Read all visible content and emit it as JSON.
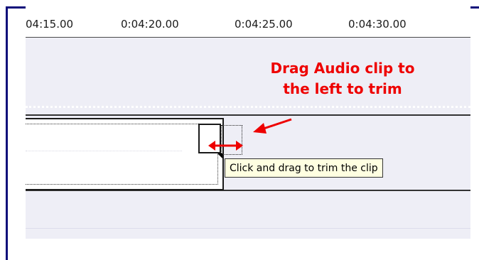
{
  "ruler": {
    "ticks": [
      "04:15.00",
      "0:04:20.00",
      "0:04:25.00",
      "0:04:30.00"
    ]
  },
  "annotation": {
    "line1": "Drag Audio clip to",
    "line2": "the left to trim",
    "color": "#ee0000"
  },
  "tooltip": {
    "text": "Click and drag to trim the clip"
  },
  "colors": {
    "frame": "#0c0c7a",
    "track_background": "#eeeef6",
    "tooltip_background": "#ffffe1"
  },
  "icons": {
    "trim_cursor": "double-arrow-horizontal-icon",
    "callout_arrow": "arrow-icon"
  }
}
